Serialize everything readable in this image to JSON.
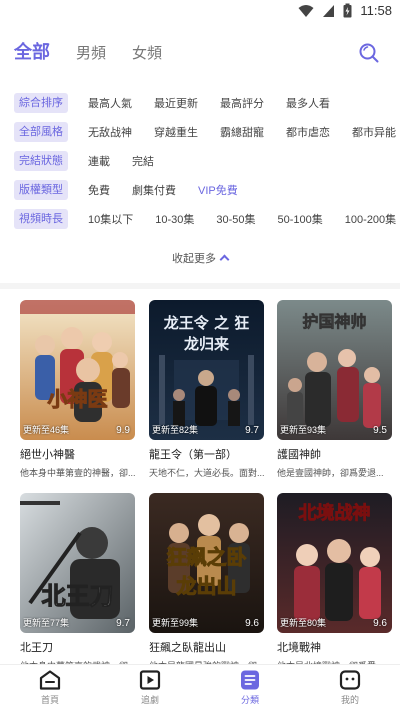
{
  "status": {
    "time": "11:58"
  },
  "tabs": [
    {
      "label": "全部"
    },
    {
      "label": "男頻"
    },
    {
      "label": "女頻"
    }
  ],
  "filters": [
    {
      "label": "綜合排序",
      "options": [
        "最高人氣",
        "最近更新",
        "最高評分",
        "最多人看"
      ]
    },
    {
      "label": "全部風格",
      "options": [
        "无敌战神",
        "穿越重生",
        "霸總甜寵",
        "都市虐恋",
        "都市异能"
      ]
    },
    {
      "label": "完結狀態",
      "options": [
        "連載",
        "完結"
      ]
    },
    {
      "label": "版權類型",
      "options": [
        "免費",
        "劇集付費",
        "VIP免費"
      ]
    },
    {
      "label": "視頻時長",
      "options": [
        "10集以下",
        "10-30集",
        "30-50集",
        "50-100集",
        "100-200集"
      ]
    }
  ],
  "collapse_label": "收起更多",
  "cards": [
    {
      "poster_text": "小神医",
      "episodes": "更新至46集",
      "score": "9.9",
      "title": "絕世小神醫",
      "desc": "他本身中華第壹的神醫，卻..."
    },
    {
      "poster_text": "龙王令 之 狂龙归来",
      "episodes": "更新至82集",
      "score": "9.7",
      "title": "龍王令（第一部）",
      "desc": "天地不仁，大道必長。面對..."
    },
    {
      "poster_text": "护国神帅",
      "episodes": "更新至93集",
      "score": "9.5",
      "title": "護國神帥",
      "desc": "他是壹國神帥，卻爲愛退..."
    },
    {
      "poster_text": "北王刀",
      "episodes": "更新至77集",
      "score": "9.7",
      "title": "北王刀",
      "desc": "他本身中華第壹的武神，卻..."
    },
    {
      "poster_text": "狂飙之卧龙出山",
      "episodes": "更新至99集",
      "score": "9.6",
      "title": "狂飆之臥龍出山",
      "desc": "他本是龍國最強的戰神，卻..."
    },
    {
      "poster_text": "北境战神",
      "episodes": "更新至80集",
      "score": "9.6",
      "title": "北境戰神",
      "desc": "他本是北境戰神，卻爲愛..."
    }
  ],
  "nav": [
    {
      "label": "首頁",
      "icon": "home-icon"
    },
    {
      "label": "追劇",
      "icon": "play-icon"
    },
    {
      "label": "分類",
      "icon": "category-icon"
    },
    {
      "label": "我的",
      "icon": "profile-icon"
    }
  ],
  "colors": {
    "accent": "#6B67E0",
    "label_bg": "#E5E3F8"
  }
}
